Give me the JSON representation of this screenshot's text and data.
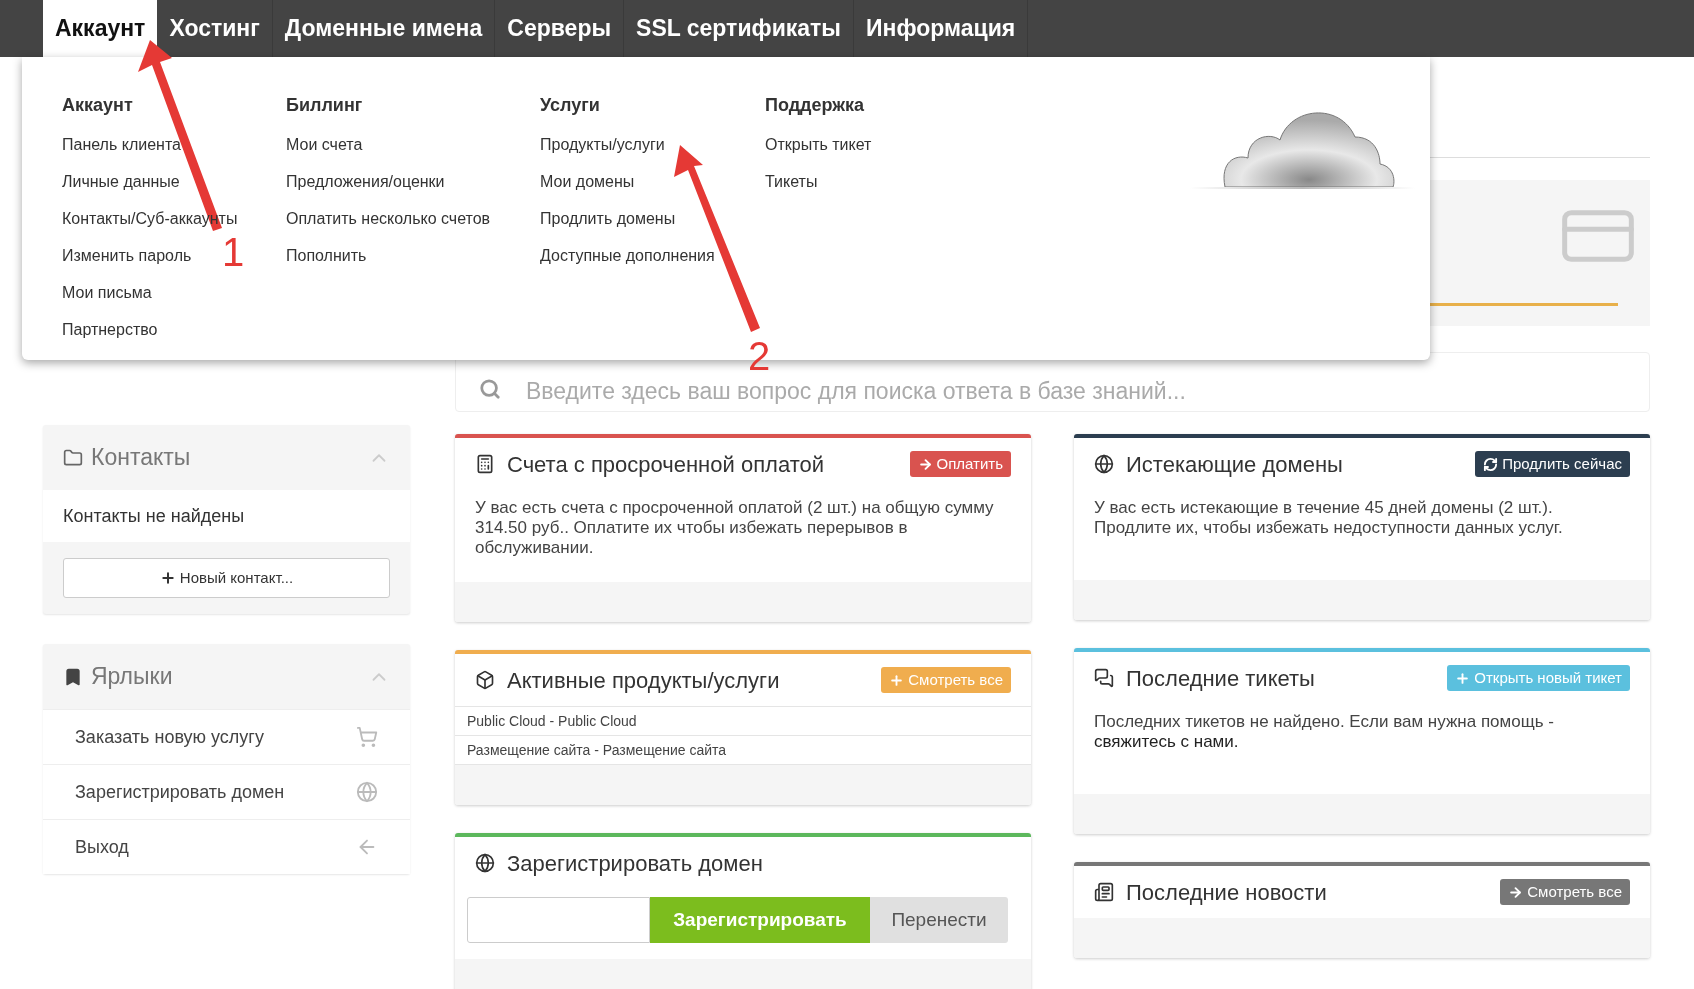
{
  "nav": {
    "tabs": [
      {
        "label": "Аккаунт",
        "selected": true
      },
      {
        "label": "Хостинг",
        "selected": false
      },
      {
        "label": "Доменные имена",
        "selected": false
      },
      {
        "label": "Серверы",
        "selected": false
      },
      {
        "label": "SSL сертификаты",
        "selected": false
      },
      {
        "label": "Информация",
        "selected": false
      }
    ]
  },
  "dropdown": {
    "columns": [
      {
        "title": "Аккаунт",
        "items": [
          "Панель клиента",
          "Личные данные",
          "Контакты/Суб-аккаунты",
          "Изменить пароль",
          "Мои письма",
          "Партнерство"
        ]
      },
      {
        "title": "Биллинг",
        "items": [
          "Мои счета",
          "Предложения/оценки",
          "Оплатить несколько счетов",
          "Пополнить"
        ]
      },
      {
        "title": "Услуги",
        "items": [
          "Продукты/услуги",
          "Мои домены",
          "Продлить домены",
          "Доступные дополнения"
        ]
      },
      {
        "title": "Поддержка",
        "items": [
          "Открыть тикет",
          "Тикеты"
        ]
      }
    ]
  },
  "annotations": [
    {
      "label": "1"
    },
    {
      "label": "2"
    }
  ],
  "sidebar": {
    "contacts": {
      "title": "Контакты",
      "empty_text": "Контакты не найдены",
      "button": "Новый контакт..."
    },
    "shortcuts": {
      "title": "Ярлыки",
      "items": [
        {
          "label": "Заказать новую услугу",
          "kind": "cart"
        },
        {
          "label": "Зарегистрировать домен",
          "kind": "globe"
        },
        {
          "label": "Выход",
          "kind": "back"
        }
      ]
    }
  },
  "search": {
    "placeholder": "Введите здесь ваш вопрос для поиска ответа в базе знаний..."
  },
  "columns": [
    [
      {
        "title": "Счета с просроченной оплатой",
        "color": "#d9534f",
        "button": "Оплатить",
        "body": "У вас есть счета с просроченной оплатой (2 шт.) на общую сумму 314.50 руб.. Оплатите их чтобы избежать перерывов в обслуживании."
      },
      {
        "title": "Активные продукты/услуги",
        "color": "#f0ad4e",
        "button": "Смотреть все",
        "rows": [
          "Public Cloud - Public Cloud",
          "Размещение сайта - Размещение сайта"
        ]
      },
      {
        "title": "Зарегистрировать домен",
        "color": "#5cb85c",
        "register": "Зарегистрировать",
        "transfer": "Перенести"
      }
    ],
    [
      {
        "title": "Истекающие домены",
        "color": "#2c3e50",
        "button": "Продлить сейчас",
        "body": "У вас есть истекающие в течение 45 дней домены (2 шт.). Продлите их, чтобы избежать недоступности данных услуг."
      },
      {
        "title": "Последние тикеты",
        "color": "#5bc0de",
        "button": "Открыть новый тикет",
        "body": "Последних тикетов не найдено. Если вам нужна помощь -",
        "link": "свяжитесь с нами."
      },
      {
        "title": "Последние новости",
        "color": "#777777",
        "button": "Смотреть все"
      }
    ]
  ]
}
